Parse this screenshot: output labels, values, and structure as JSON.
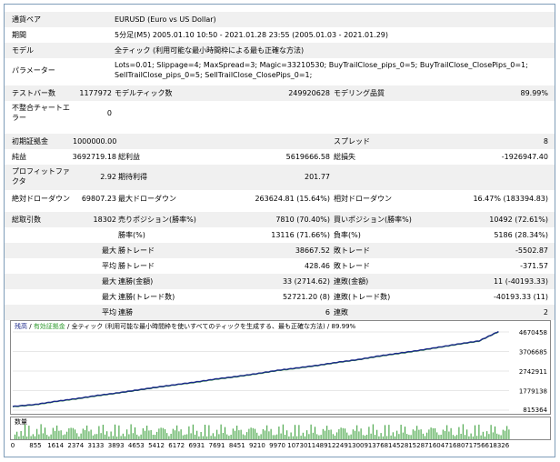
{
  "report": {
    "rows": [
      {
        "cells": [
          {
            "label": "通貨ペア",
            "value": "EURUSD (Euro vs US Dollar)"
          }
        ]
      },
      {
        "cells": [
          {
            "label": "期間",
            "value": "5分足(M5) 2005.01.10 10:50 - 2021.01.28 23:55 (2005.01.03 - 2021.01.29)"
          }
        ]
      },
      {
        "cells": [
          {
            "label": "モデル",
            "value": "全ティック (利用可能な最小時間枠による最も正確な方法)"
          }
        ]
      },
      {
        "cells": [
          {
            "label": "パラメーター",
            "value": "Lots=0.01; Slippage=4; MaxSpread=3; Magic=33210530; BuyTrailClose_pips_0=5; BuyTrailClose_ClosePips_0=1; SellTrailClose_pips_0=5; SellTrailClose_ClosePips_0=1;"
          }
        ]
      }
    ],
    "bars_label": "テストバー数",
    "bars_value": "1177972",
    "ticks_label": "モデルティック数",
    "ticks_value": "249920628",
    "quality_label": "モデリング品質",
    "quality_value": "89.99%",
    "mismatch_label": "不整合チャートエラー",
    "mismatch_value": "0",
    "deposit_label": "初期証拠金",
    "deposit_value": "1000000.00",
    "spread_label": "スプレッド",
    "spread_value": "8",
    "net_label": "純益",
    "net_value": "3692719.18",
    "gross_profit_label": "総利益",
    "gross_profit_value": "5619666.58",
    "gross_loss_label": "総損失",
    "gross_loss_value": "-1926947.40",
    "pf_label": "プロフィットファクタ",
    "pf_value": "2.92",
    "payoff_label": "期待利得",
    "payoff_value": "201.77",
    "abs_dd_label": "絶対ドローダウン",
    "abs_dd_value": "69807.23",
    "max_dd_label": "最大ドローダウン",
    "max_dd_value": "263624.81 (15.64%)",
    "rel_dd_label": "相対ドローダウン",
    "rel_dd_value": "16.47% (183394.83)",
    "trades_label": "総取引数",
    "trades_value": "18302",
    "short_label": "売りポジション(勝率%)",
    "short_value": "7810 (70.40%)",
    "long_label": "買いポジション(勝率%)",
    "long_value": "10492 (72.61%)",
    "win_label": "勝率(%)",
    "win_value": "13116 (71.66%)",
    "loss_label": "負率(%)",
    "loss_value": "5186 (28.34%)",
    "max_word": "最大",
    "avg_word": "平均",
    "lw_label": "勝トレード",
    "lw_value": "38667.52",
    "ll_label": "敗トレード",
    "ll_value": "-5502.87",
    "aw_label": "勝トレード",
    "aw_value": "428.46",
    "al_label": "敗トレード",
    "al_value": "-371.57",
    "mcw_label": "連勝(金額)",
    "mcw_value": "33 (2714.62)",
    "mcl_label": "連敗(金額)",
    "mcl_value": "11 (-40193.33)",
    "mcp_label": "連勝(トレード数)",
    "mcp_value": "52721.20 (8)",
    "mcll_label": "連敗(トレード数)",
    "mcll_value": "-40193.33 (11)",
    "acw_label": "連勝",
    "acw_value": "6",
    "acl_label": "連敗",
    "acl_value": "2"
  },
  "graph": {
    "legend_balance": "残高",
    "legend_sep": " / ",
    "legend_equity": "有効証拠金",
    "legend_rest": " / 全ティック (利用可能な最小時間枠を使いすべてのティックを生成する、最も正確な方法) / 89.99%",
    "hist_label": "数量",
    "colors": {
      "balance": "#1c2a8a",
      "equity": "#2e9a2e",
      "hist": "#2e9a2e",
      "grid": "#cfcfcf"
    }
  },
  "chart_data": {
    "type": "line",
    "title": "",
    "ylim": [
      815364,
      4670458
    ],
    "y_ticks": [
      "4670458",
      "3706685",
      "2742911",
      "1779138",
      "815364"
    ],
    "x_ticks": [
      "0",
      "855",
      "1614",
      "2374",
      "3133",
      "3893",
      "4653",
      "5412",
      "6172",
      "6931",
      "7691",
      "8451",
      "9210",
      "9970",
      "10730",
      "11489",
      "12249",
      "13009",
      "13768",
      "14528",
      "15287",
      "16047",
      "16807",
      "17566",
      "18326"
    ],
    "series": [
      {
        "x": [
          0,
          855,
          1614,
          2374,
          3133,
          3893,
          4653,
          5412,
          6172,
          6931,
          7691,
          8451,
          9210,
          9970,
          10730,
          11489,
          12249,
          13009,
          13768,
          14528,
          15287,
          16047,
          16807,
          17566,
          18302
        ],
        "values": [
          1000000,
          1100000,
          1250000,
          1380000,
          1530000,
          1660000,
          1800000,
          1950000,
          2080000,
          2210000,
          2360000,
          2480000,
          2620000,
          2780000,
          2900000,
          3030000,
          3180000,
          3310000,
          3480000,
          3620000,
          3760000,
          3920000,
          4080000,
          4230000,
          4692719
        ]
      }
    ]
  }
}
